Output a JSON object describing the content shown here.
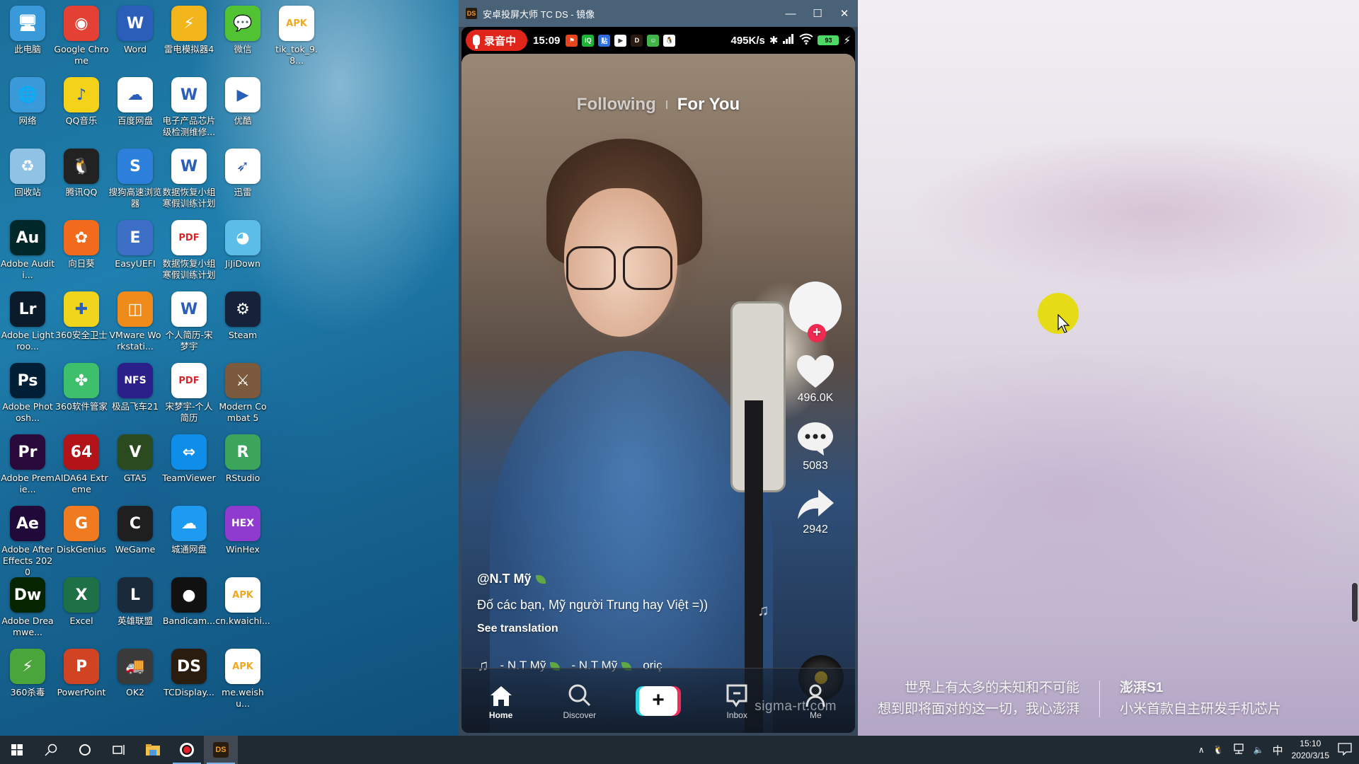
{
  "desktop": {
    "icons": [
      {
        "label": "此电脑",
        "glyph": "🖥",
        "color": "#3a9ad9"
      },
      {
        "label": "Google Chrome",
        "glyph": "◉",
        "color": "#e34133"
      },
      {
        "label": "Word",
        "glyph": "W",
        "color": "#2b5eb8"
      },
      {
        "label": "雷电模拟器4",
        "glyph": "⚡",
        "color": "#f2b51b"
      },
      {
        "label": "微信",
        "glyph": "💬",
        "color": "#51c332"
      },
      {
        "label": "tik_tok_9.8...",
        "glyph": "APK",
        "color": "#ffffff"
      },
      {
        "label": "网络",
        "glyph": "🌐",
        "color": "#3a9ad9"
      },
      {
        "label": "QQ音乐",
        "glyph": "♪",
        "color": "#f4d21a"
      },
      {
        "label": "百度网盘",
        "glyph": "☁",
        "color": "#ffffff"
      },
      {
        "label": "电子产品芯片级检测维修...",
        "glyph": "W",
        "color": "#ffffff"
      },
      {
        "label": "优酷",
        "glyph": "▶",
        "color": "#ffffff"
      },
      {
        "label": "回收站",
        "glyph": "♻",
        "color": "#8fc3e6"
      },
      {
        "label": "腾讯QQ",
        "glyph": "🐧",
        "color": "#222222"
      },
      {
        "label": "搜狗高速浏览器",
        "glyph": "S",
        "color": "#2d7fdc"
      },
      {
        "label": "数据恢复小组寒假训练计划",
        "glyph": "W",
        "color": "#ffffff"
      },
      {
        "label": "迅雷",
        "glyph": "➶",
        "color": "#ffffff"
      },
      {
        "label": "Adobe Auditi...",
        "glyph": "Au",
        "color": "#00272a"
      },
      {
        "label": "向日葵",
        "glyph": "✿",
        "color": "#f26b1d"
      },
      {
        "label": "EasyUEFI",
        "glyph": "E",
        "color": "#3c6fc5"
      },
      {
        "label": "数据恢复小组寒假训练计划",
        "glyph": "PDF",
        "color": "#ffffff"
      },
      {
        "label": "JiJiDown",
        "glyph": "◕",
        "color": "#5dbde9"
      },
      {
        "label": "Adobe Lightroo...",
        "glyph": "Lr",
        "color": "#0b1b2a"
      },
      {
        "label": "360安全卫士",
        "glyph": "✚",
        "color": "#f1d51c"
      },
      {
        "label": "VMware Workstati...",
        "glyph": "◫",
        "color": "#ef8b1a"
      },
      {
        "label": "个人简历-宋梦宇",
        "glyph": "W",
        "color": "#ffffff"
      },
      {
        "label": "Steam",
        "glyph": "⚙",
        "color": "#16223a"
      },
      {
        "label": "Adobe Photosh...",
        "glyph": "Ps",
        "color": "#001e36"
      },
      {
        "label": "360软件管家",
        "glyph": "✤",
        "color": "#3dbf6b"
      },
      {
        "label": "极品飞车21",
        "glyph": "NFS",
        "color": "#2b1f8a"
      },
      {
        "label": "宋梦宇-个人简历",
        "glyph": "PDF",
        "color": "#ffffff"
      },
      {
        "label": "Modern Combat 5",
        "glyph": "⚔",
        "color": "#7b5a3e"
      },
      {
        "label": "Adobe Premie...",
        "glyph": "Pr",
        "color": "#2a0a3a"
      },
      {
        "label": "AIDA64 Extreme",
        "glyph": "64",
        "color": "#b3141a"
      },
      {
        "label": "GTA5",
        "glyph": "V",
        "color": "#2b4a1f"
      },
      {
        "label": "TeamViewer",
        "glyph": "⇔",
        "color": "#0e8ee9"
      },
      {
        "label": "RStudio",
        "glyph": "R",
        "color": "#3ba55b"
      },
      {
        "label": "Adobe After Effects 2020",
        "glyph": "Ae",
        "color": "#1f0a3a"
      },
      {
        "label": "DiskGenius",
        "glyph": "G",
        "color": "#ef7a1f"
      },
      {
        "label": "WeGame",
        "glyph": "C",
        "color": "#1f1f1f"
      },
      {
        "label": "城通网盘",
        "glyph": "☁",
        "color": "#1e9af0"
      },
      {
        "label": "WinHex",
        "glyph": "HEX",
        "color": "#8f3bd0"
      },
      {
        "label": "Adobe Dreamwe...",
        "glyph": "Dw",
        "color": "#072401"
      },
      {
        "label": "Excel",
        "glyph": "X",
        "color": "#1e7145"
      },
      {
        "label": "英雄联盟",
        "glyph": "L",
        "color": "#1a2a3a"
      },
      {
        "label": "Bandicam...",
        "glyph": "●",
        "color": "#111111"
      },
      {
        "label": "cn.kwaichi...",
        "glyph": "APK",
        "color": "#ffffff"
      },
      {
        "label": "360杀毒",
        "glyph": "⚡",
        "color": "#4aa63a"
      },
      {
        "label": "PowerPoint",
        "glyph": "P",
        "color": "#d04423"
      },
      {
        "label": "OK2",
        "glyph": "🚚",
        "color": "#3a3a3a"
      },
      {
        "label": "TCDisplay...",
        "glyph": "DS",
        "color": "#2a1d10"
      },
      {
        "label": "me.weishu...",
        "glyph": "APK",
        "color": "#ffffff"
      }
    ]
  },
  "window": {
    "title": "安卓投屏大师 TC DS - 镜像",
    "logo": "DS",
    "minimize": "—",
    "maximize": "☐",
    "close": "✕"
  },
  "phone": {
    "status": {
      "recording_label": "录音中",
      "time": "15:09",
      "net_speed": "495K/s",
      "battery": "93",
      "app_icons": [
        {
          "name": "news-app-icon",
          "color": "#e8451f",
          "glyph": "⚑"
        },
        {
          "name": "iqiyi-icon",
          "color": "#20b33a",
          "glyph": "iQ"
        },
        {
          "name": "tieba-icon",
          "color": "#2f6ee0",
          "glyph": "贴"
        },
        {
          "name": "youku-icon",
          "color": "#ffffff",
          "glyph": "▶"
        },
        {
          "name": "d-app-icon",
          "color": "#2a1a10",
          "glyph": "D"
        },
        {
          "name": "android-app-icon",
          "color": "#3fb54a",
          "glyph": "☺"
        },
        {
          "name": "qq-icon",
          "color": "#ffffff",
          "glyph": "🐧"
        }
      ]
    },
    "feed_tabs": {
      "following": "Following",
      "for_you": "For You"
    },
    "rail": {
      "likes": "496.0K",
      "comments": "5083",
      "shares": "2942"
    },
    "caption": {
      "username": "@N.T Mỹ",
      "description": "Đố các bạn, Mỹ người Trung hay Việt =))",
      "see_translation": "See translation"
    },
    "music": {
      "text1": "- N.T Mỹ",
      "text2": "- N.T Mỹ",
      "text3": "oriç"
    },
    "nav": {
      "home": "Home",
      "discover": "Discover",
      "create": "+",
      "inbox": "Inbox",
      "me": "Me"
    },
    "watermark": "sigma-rt.com"
  },
  "ad": {
    "line1": "世界上有太多的未知和不可能",
    "line2": "想到即将面对的这一切，我心澎湃",
    "brand": "澎湃S1",
    "tagline": "小米首款自主研发手机芯片"
  },
  "taskbar": {
    "time": "15:10",
    "date": "2020/3/15",
    "ime": "中"
  }
}
